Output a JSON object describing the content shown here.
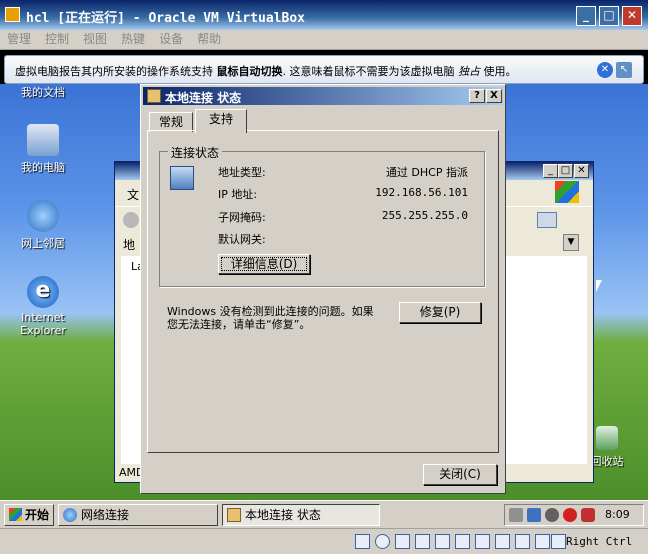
{
  "vbox": {
    "title": "hcl [正在运行] - Oracle VM VirtualBox",
    "menu": [
      "管理",
      "控制",
      "视图",
      "热键",
      "设备",
      "帮助"
    ],
    "notify_pre": "虚拟电脑报告其内所安装的操作系统支持",
    "notify_bold": "鼠标自动切换",
    "notify_post": ". 这意味着鼠标不需要为该虚拟电脑",
    "notify_italic": "独占",
    "notify_end": "使用。",
    "hostkey": "Right Ctrl"
  },
  "desktop_icons": [
    {
      "label": "我的文档"
    },
    {
      "label": "我的电脑"
    },
    {
      "label": "网上邻居"
    },
    {
      "label": "Internet Explorer"
    },
    {
      "label": "回收站"
    }
  ],
  "explorer": {
    "menu_fragment": "文",
    "addr_fragment": "地",
    "item_fragment": "La",
    "status_fragment": "AMD"
  },
  "dialog": {
    "title": "本地连接 状态",
    "help": "?",
    "close": "X",
    "tabs": [
      "常规",
      "支持"
    ],
    "active_tab": 1,
    "group_title": "连接状态",
    "fields": [
      {
        "label": "地址类型:",
        "value": "通过 DHCP 指派"
      },
      {
        "label": "IP 地址:",
        "value": "192.168.56.101"
      },
      {
        "label": "子网掩码:",
        "value": "255.255.255.0"
      },
      {
        "label": "默认网关:",
        "value": ""
      }
    ],
    "details_button": "详细信息(D)",
    "repair_text_1": "Windows 没有检测到此连接的问题。如果",
    "repair_text_2": "您无法连接，请单击“修复”。",
    "repair_button": "修复(P)",
    "close_button": "关闭(C)"
  },
  "taskbar": {
    "start": "开始",
    "tasks": [
      "网络连接",
      "本地连接 状态"
    ],
    "active_task": 1,
    "clock": "8:09"
  }
}
